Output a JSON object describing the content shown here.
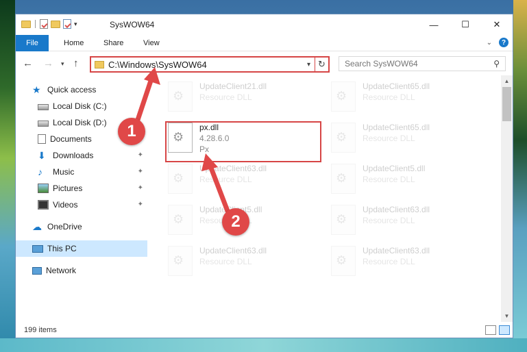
{
  "window": {
    "title": "SysWOW64",
    "controls": {
      "minimize": "—",
      "maximize": "☐",
      "close": "✕"
    }
  },
  "ribbon": {
    "tabs": [
      "File",
      "Home",
      "Share",
      "View"
    ]
  },
  "address_bar": {
    "path": "C:\\Windows\\SysWOW64"
  },
  "search": {
    "placeholder": "Search SysWOW64"
  },
  "sidebar": {
    "items": [
      {
        "label": "Quick access",
        "icon": "star-icon"
      },
      {
        "label": "Local Disk (C:)",
        "icon": "disk-icon"
      },
      {
        "label": "Local Disk (D:)",
        "icon": "disk-icon"
      },
      {
        "label": "Documents",
        "icon": "documents-icon",
        "pinned": true
      },
      {
        "label": "Downloads",
        "icon": "download-icon",
        "pinned": true
      },
      {
        "label": "Music",
        "icon": "music-icon",
        "pinned": true
      },
      {
        "label": "Pictures",
        "icon": "pictures-icon",
        "pinned": true
      },
      {
        "label": "Videos",
        "icon": "videos-icon",
        "pinned": true
      },
      {
        "label": "OneDrive",
        "icon": "cloud-icon"
      },
      {
        "label": "This PC",
        "icon": "pc-icon",
        "selected": true
      },
      {
        "label": "Network",
        "icon": "network-icon"
      }
    ]
  },
  "files": [
    {
      "name": "UpdateClient21.dll",
      "desc": "Resource DLL",
      "faded": true
    },
    {
      "name": "UpdateClient65.dll",
      "desc": "Resource DLL",
      "faded": true
    },
    {
      "name": "px.dll",
      "version": "4.28.6.0",
      "desc": "Px",
      "faded": false
    },
    {
      "name": "UpdateClient65.dll",
      "desc": "Resource DLL",
      "faded": true
    },
    {
      "name": "UpdateClient63.dll",
      "desc": "Resource DLL",
      "faded": true
    },
    {
      "name": "UpdateClient5.dll",
      "desc": "Resource DLL",
      "faded": true
    },
    {
      "name": "UpdateClient5.dll",
      "desc": "Resource DLL",
      "faded": true
    },
    {
      "name": "UpdateClient63.dll",
      "desc": "Resource DLL",
      "faded": true
    },
    {
      "name": "UpdateClient63.dll",
      "desc": "Resource DLL",
      "faded": true
    },
    {
      "name": "UpdateClient63.dll",
      "desc": "Resource DLL",
      "faded": true
    }
  ],
  "status": {
    "item_count": "199 items"
  },
  "callouts": {
    "step1": "1",
    "step2": "2",
    "color": "#e04848"
  },
  "colors": {
    "accent": "#1979ca",
    "highlight_border": "#d64545",
    "selection": "#cde8ff"
  }
}
